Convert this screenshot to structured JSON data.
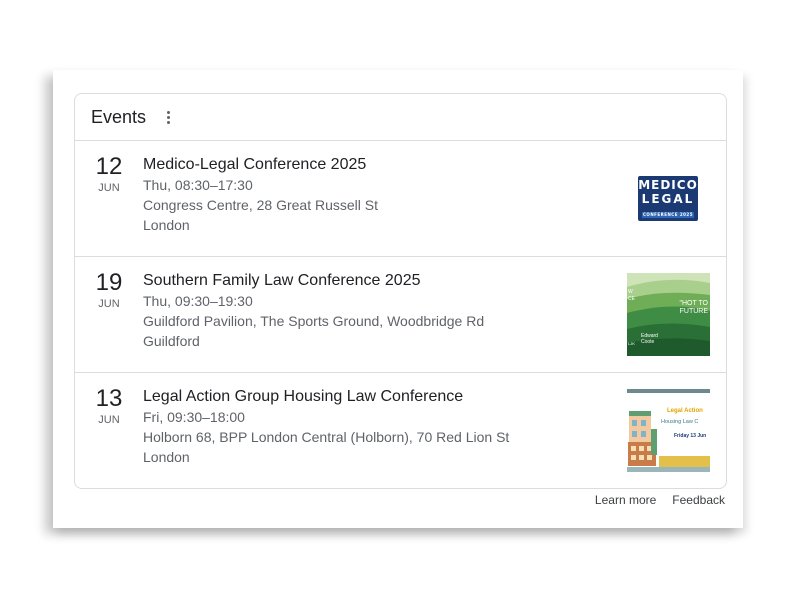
{
  "widget": {
    "title": "Events",
    "menu_icon": "more-vert-icon"
  },
  "events": [
    {
      "day": "12",
      "month": "JUN",
      "title": "Medico-Legal Conference 2025",
      "time": "Thu, 08:30–17:30",
      "venue": "Congress Centre, 28 Great Russell St",
      "city": "London",
      "thumb": {
        "line1": "MEDICO",
        "line2": "LEGAL",
        "line3": "CONFERENCE 2025",
        "bg_color": "#1b3a73"
      }
    },
    {
      "day": "19",
      "month": "JUN",
      "title": "Southern Family Law Conference 2025",
      "time": "Thu, 09:30–19:30",
      "venue": "Guildford Pavilion, The Sports Ground, Woodbridge Rd",
      "city": "Guildford",
      "thumb": {
        "left_text": "W\nCE",
        "right_text": "\"HOT TO\nFUTURE",
        "logo_text": "Edward\nCoote",
        "corner_text": "LJK"
      }
    },
    {
      "day": "13",
      "month": "JUN",
      "title": "Legal Action Group Housing Law Conference",
      "time": "Fri, 09:30–18:00",
      "venue": "Holborn 68, BPP London Central (Holborn), 70 Red Lion St",
      "city": "London",
      "thumb": {
        "title": "Legal Action",
        "subtitle": "Housing Law C",
        "date": "Friday 13 Jun"
      }
    }
  ],
  "footer": {
    "learn_more": "Learn more",
    "feedback": "Feedback"
  }
}
